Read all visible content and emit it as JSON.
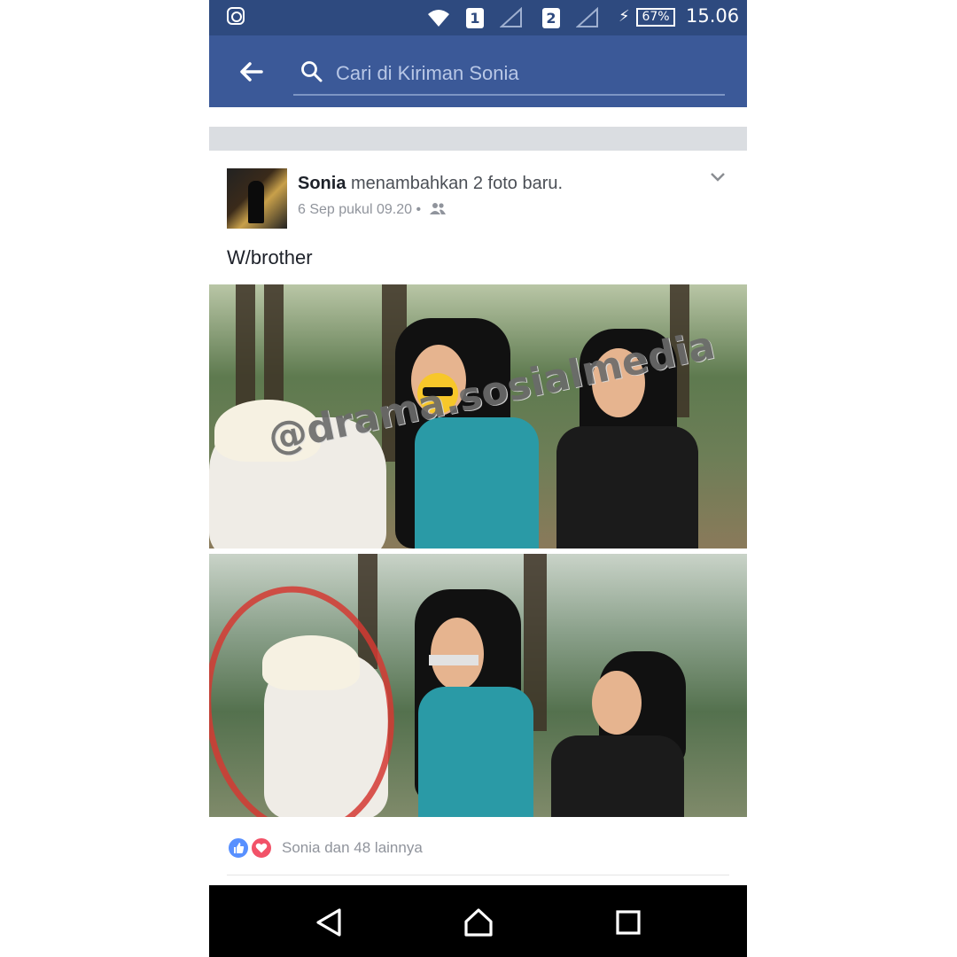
{
  "status_bar": {
    "sim1": "1",
    "sim2": "2",
    "battery": "67%",
    "time": "15.06"
  },
  "app_bar": {
    "search_placeholder": "Cari di Kiriman Sonia"
  },
  "post": {
    "author": "Sonia",
    "action": "menambahkan 2 foto baru.",
    "date": "6 Sep pukul 09.20",
    "separator": "•",
    "audience_icon": "friends-icon",
    "text": "W/brother",
    "watermark": "@drama.sosialmedia",
    "reactions_text": "Sonia dan 48 lainnya"
  },
  "colors": {
    "status_bar": "#2e4a7f",
    "app_bar": "#3b5998",
    "like": "#5890ff",
    "love": "#f25268",
    "annotation": "#d43a32"
  },
  "nav_bar": {
    "icons": [
      "back-triangle-icon",
      "home-circle-icon",
      "recents-square-icon"
    ]
  }
}
